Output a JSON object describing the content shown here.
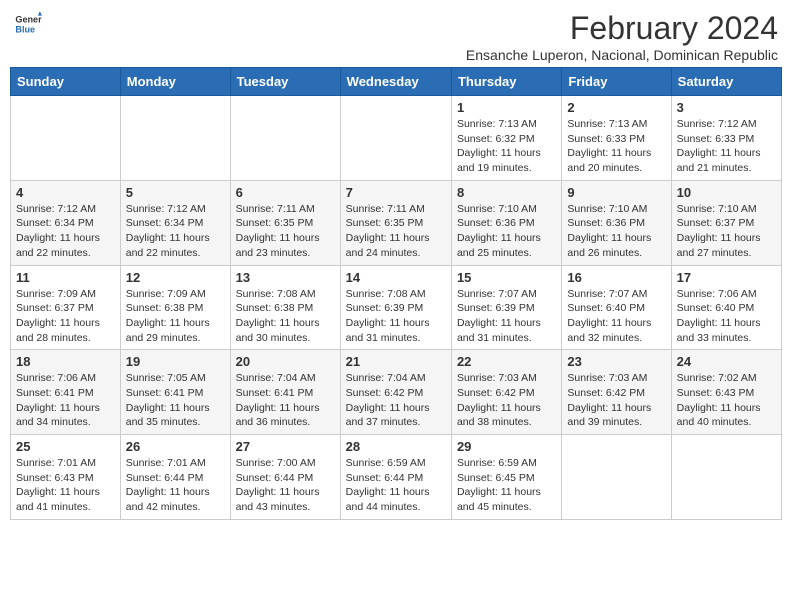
{
  "header": {
    "logo_general": "General",
    "logo_blue": "Blue",
    "month_year": "February 2024",
    "location": "Ensanche Luperon, Nacional, Dominican Republic"
  },
  "days_of_week": [
    "Sunday",
    "Monday",
    "Tuesday",
    "Wednesday",
    "Thursday",
    "Friday",
    "Saturday"
  ],
  "weeks": [
    [
      {
        "day": "",
        "info": ""
      },
      {
        "day": "",
        "info": ""
      },
      {
        "day": "",
        "info": ""
      },
      {
        "day": "",
        "info": ""
      },
      {
        "day": "1",
        "info": "Sunrise: 7:13 AM\nSunset: 6:32 PM\nDaylight: 11 hours and 19 minutes."
      },
      {
        "day": "2",
        "info": "Sunrise: 7:13 AM\nSunset: 6:33 PM\nDaylight: 11 hours and 20 minutes."
      },
      {
        "day": "3",
        "info": "Sunrise: 7:12 AM\nSunset: 6:33 PM\nDaylight: 11 hours and 21 minutes."
      }
    ],
    [
      {
        "day": "4",
        "info": "Sunrise: 7:12 AM\nSunset: 6:34 PM\nDaylight: 11 hours and 22 minutes."
      },
      {
        "day": "5",
        "info": "Sunrise: 7:12 AM\nSunset: 6:34 PM\nDaylight: 11 hours and 22 minutes."
      },
      {
        "day": "6",
        "info": "Sunrise: 7:11 AM\nSunset: 6:35 PM\nDaylight: 11 hours and 23 minutes."
      },
      {
        "day": "7",
        "info": "Sunrise: 7:11 AM\nSunset: 6:35 PM\nDaylight: 11 hours and 24 minutes."
      },
      {
        "day": "8",
        "info": "Sunrise: 7:10 AM\nSunset: 6:36 PM\nDaylight: 11 hours and 25 minutes."
      },
      {
        "day": "9",
        "info": "Sunrise: 7:10 AM\nSunset: 6:36 PM\nDaylight: 11 hours and 26 minutes."
      },
      {
        "day": "10",
        "info": "Sunrise: 7:10 AM\nSunset: 6:37 PM\nDaylight: 11 hours and 27 minutes."
      }
    ],
    [
      {
        "day": "11",
        "info": "Sunrise: 7:09 AM\nSunset: 6:37 PM\nDaylight: 11 hours and 28 minutes."
      },
      {
        "day": "12",
        "info": "Sunrise: 7:09 AM\nSunset: 6:38 PM\nDaylight: 11 hours and 29 minutes."
      },
      {
        "day": "13",
        "info": "Sunrise: 7:08 AM\nSunset: 6:38 PM\nDaylight: 11 hours and 30 minutes."
      },
      {
        "day": "14",
        "info": "Sunrise: 7:08 AM\nSunset: 6:39 PM\nDaylight: 11 hours and 31 minutes."
      },
      {
        "day": "15",
        "info": "Sunrise: 7:07 AM\nSunset: 6:39 PM\nDaylight: 11 hours and 31 minutes."
      },
      {
        "day": "16",
        "info": "Sunrise: 7:07 AM\nSunset: 6:40 PM\nDaylight: 11 hours and 32 minutes."
      },
      {
        "day": "17",
        "info": "Sunrise: 7:06 AM\nSunset: 6:40 PM\nDaylight: 11 hours and 33 minutes."
      }
    ],
    [
      {
        "day": "18",
        "info": "Sunrise: 7:06 AM\nSunset: 6:41 PM\nDaylight: 11 hours and 34 minutes."
      },
      {
        "day": "19",
        "info": "Sunrise: 7:05 AM\nSunset: 6:41 PM\nDaylight: 11 hours and 35 minutes."
      },
      {
        "day": "20",
        "info": "Sunrise: 7:04 AM\nSunset: 6:41 PM\nDaylight: 11 hours and 36 minutes."
      },
      {
        "day": "21",
        "info": "Sunrise: 7:04 AM\nSunset: 6:42 PM\nDaylight: 11 hours and 37 minutes."
      },
      {
        "day": "22",
        "info": "Sunrise: 7:03 AM\nSunset: 6:42 PM\nDaylight: 11 hours and 38 minutes."
      },
      {
        "day": "23",
        "info": "Sunrise: 7:03 AM\nSunset: 6:42 PM\nDaylight: 11 hours and 39 minutes."
      },
      {
        "day": "24",
        "info": "Sunrise: 7:02 AM\nSunset: 6:43 PM\nDaylight: 11 hours and 40 minutes."
      }
    ],
    [
      {
        "day": "25",
        "info": "Sunrise: 7:01 AM\nSunset: 6:43 PM\nDaylight: 11 hours and 41 minutes."
      },
      {
        "day": "26",
        "info": "Sunrise: 7:01 AM\nSunset: 6:44 PM\nDaylight: 11 hours and 42 minutes."
      },
      {
        "day": "27",
        "info": "Sunrise: 7:00 AM\nSunset: 6:44 PM\nDaylight: 11 hours and 43 minutes."
      },
      {
        "day": "28",
        "info": "Sunrise: 6:59 AM\nSunset: 6:44 PM\nDaylight: 11 hours and 44 minutes."
      },
      {
        "day": "29",
        "info": "Sunrise: 6:59 AM\nSunset: 6:45 PM\nDaylight: 11 hours and 45 minutes."
      },
      {
        "day": "",
        "info": ""
      },
      {
        "day": "",
        "info": ""
      }
    ]
  ]
}
